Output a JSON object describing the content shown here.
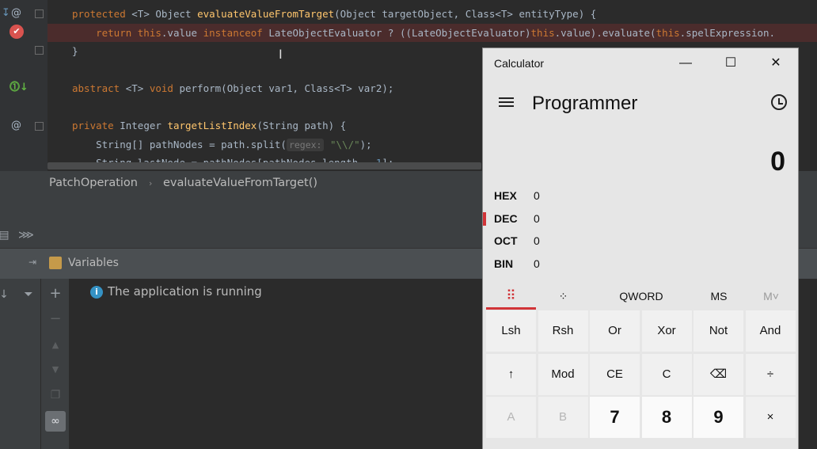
{
  "editor": {
    "lines": [
      {
        "kind": "plain",
        "segments": [
          {
            "t": "protected ",
            "c": "kw"
          },
          {
            "t": "<T> Object ",
            "c": "ty"
          },
          {
            "t": "evaluateValueFromTarget",
            "c": "fn"
          },
          {
            "t": "(Object targetObject, Class<T> entityType) {",
            "c": "ty"
          }
        ]
      },
      {
        "kind": "error",
        "segments": [
          {
            "t": "    return this",
            "c": "kw"
          },
          {
            "t": ".value ",
            "c": "ty"
          },
          {
            "t": "instanceof ",
            "c": "kw"
          },
          {
            "t": "LateObjectEvaluator ? ((LateObjectEvaluator)",
            "c": "ty"
          },
          {
            "t": "this",
            "c": "kw"
          },
          {
            "t": ".value).evaluate(",
            "c": "ty"
          },
          {
            "t": "this",
            "c": "kw"
          },
          {
            "t": ".spelExpression.",
            "c": "ty"
          }
        ]
      },
      {
        "kind": "plain",
        "segments": [
          {
            "t": "}",
            "c": "ty"
          }
        ]
      },
      {
        "kind": "plain",
        "segments": []
      },
      {
        "kind": "plain",
        "segments": [
          {
            "t": "abstract ",
            "c": "kw"
          },
          {
            "t": "<T> ",
            "c": "ty"
          },
          {
            "t": "void ",
            "c": "kw"
          },
          {
            "t": "perform(Object var1, Class<T> var2);",
            "c": "ty"
          }
        ]
      },
      {
        "kind": "plain",
        "segments": []
      },
      {
        "kind": "plain",
        "segments": [
          {
            "t": "private ",
            "c": "kw"
          },
          {
            "t": "Integer ",
            "c": "ty"
          },
          {
            "t": "targetListIndex",
            "c": "fn"
          },
          {
            "t": "(String path) {",
            "c": "ty"
          }
        ]
      },
      {
        "kind": "plain",
        "segments": [
          {
            "t": "    String[] pathNodes = path.split(",
            "c": "ty"
          },
          {
            "t": "regex:",
            "c": "hint"
          },
          {
            "t": " \"\\\\/\"",
            "c": "str"
          },
          {
            "t": ");",
            "c": "ty"
          }
        ]
      },
      {
        "kind": "plain",
        "segments": [
          {
            "t": "    String lastNode = pathNodes[pathNodes.length - ",
            "c": "ty"
          },
          {
            "t": "1",
            "c": "num"
          },
          {
            "t": "];",
            "c": "ty"
          }
        ]
      }
    ]
  },
  "breadcrumb": {
    "class_name": "PatchOperation",
    "method_name": "evaluateValueFromTarget()"
  },
  "debug": {
    "variables_label": "Variables",
    "status_text": "The application is running",
    "info_glyph": "i"
  },
  "calculator": {
    "title": "Calculator",
    "mode": "Programmer",
    "display": "0",
    "radix": [
      {
        "label": "HEX",
        "value": "0"
      },
      {
        "label": "DEC",
        "value": "0"
      },
      {
        "label": "OCT",
        "value": "0"
      },
      {
        "label": "BIN",
        "value": "0"
      }
    ],
    "selected_radix": "DEC",
    "tabs": {
      "word_size": "QWORD",
      "memory_store": "MS",
      "memory_menu": "M˅"
    },
    "keys": [
      [
        "Lsh",
        "Rsh",
        "Or",
        "Xor",
        "Not",
        "And"
      ],
      [
        "↑",
        "Mod",
        "CE",
        "C",
        "⌫",
        "÷"
      ],
      [
        "A",
        "B",
        "7",
        "8",
        "9",
        "×"
      ]
    ],
    "win_buttons": {
      "minimize": "—",
      "maximize": "☐",
      "close": "✕"
    },
    "accent": "#d13438"
  }
}
